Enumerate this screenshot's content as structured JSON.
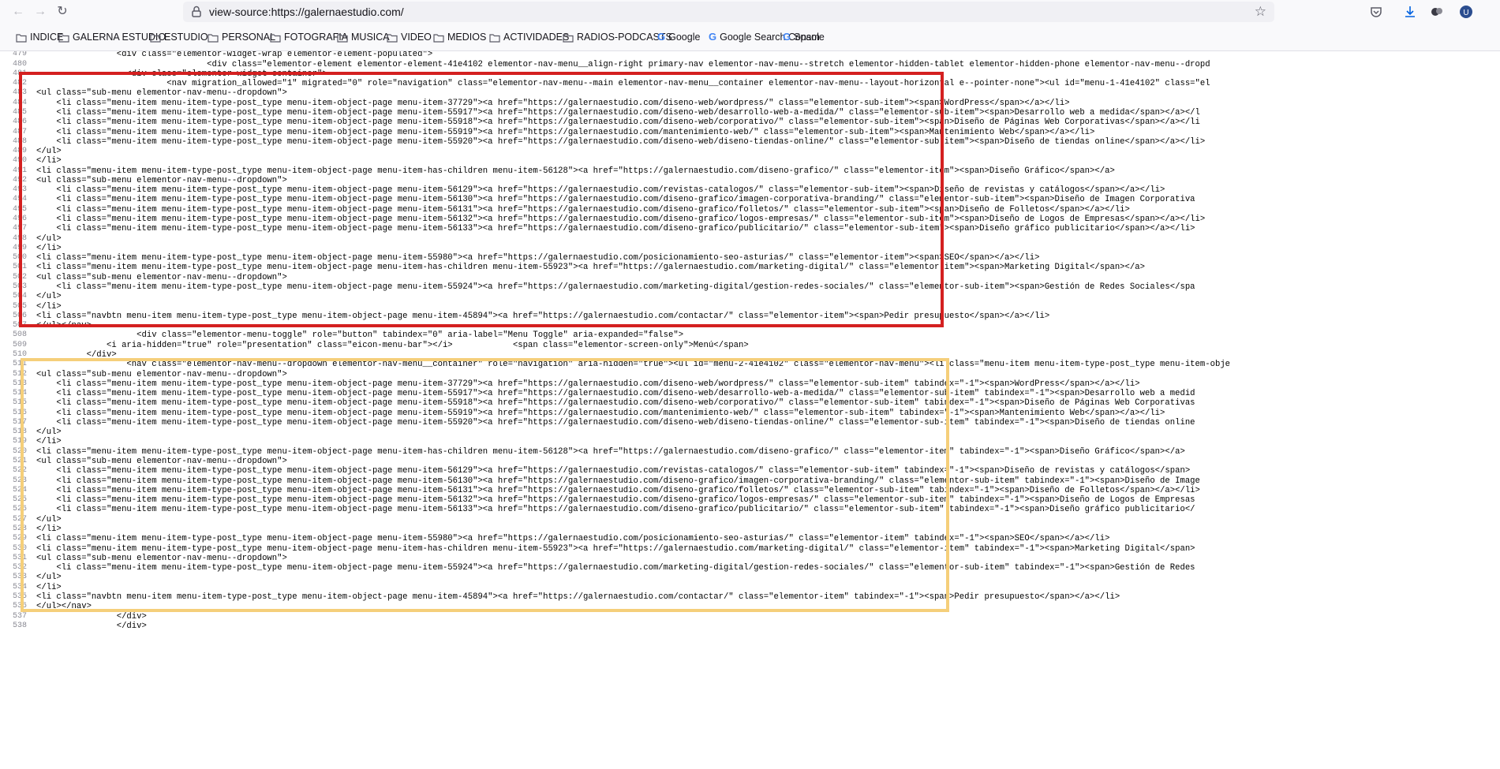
{
  "browser": {
    "url": "view-source:https://galernaestudio.com/",
    "nav_icons": [
      "back-arrow-icon",
      "forward-arrow-icon",
      "reload-icon"
    ],
    "right_icons": [
      "pocket-icon",
      "download-icon",
      "extension-icon",
      "profile-icon"
    ]
  },
  "bookmarks": [
    {
      "label": "INDICE",
      "icon": "folder-icon"
    },
    {
      "label": "GALERNA ESTUDIO",
      "icon": "folder-icon"
    },
    {
      "label": "ESTUDIO",
      "icon": "folder-icon"
    },
    {
      "label": "PERSONAL",
      "icon": "folder-icon"
    },
    {
      "label": "FOTOGRAFIA",
      "icon": "folder-icon"
    },
    {
      "label": "MUSICA",
      "icon": "folder-icon"
    },
    {
      "label": "VIDEO",
      "icon": "folder-icon"
    },
    {
      "label": "MEDIOS",
      "icon": "folder-icon"
    },
    {
      "label": "ACTIVIDADES",
      "icon": "folder-icon"
    },
    {
      "label": "RADIOS-PODCASTS",
      "icon": "folder-icon"
    },
    {
      "label": "Google",
      "icon": "google-icon"
    },
    {
      "label": "Google Search Console",
      "icon": "google-icon"
    },
    {
      "label": "Spam",
      "icon": "google-icon"
    }
  ],
  "highlights": {
    "red": "#d42020",
    "yellow": "#f5cf7a"
  },
  "source_lines": [
    {
      "n": "",
      "text": "                    <div class=\"elementor-widget-wrap elementor-element-populated\">"
    },
    {
      "n": "479",
      "text": "                <div class=\"elementor-widget-wrap elementor-element-populated\">"
    },
    {
      "n": "480",
      "text": "                                  <div class=\"elementor-element elementor-element-41e4102 elementor-nav-menu__align-right primary-nav elementor-nav-menu--stretch elementor-hidden-tablet elementor-hidden-phone elementor-nav-menu--dropd"
    },
    {
      "n": "481",
      "text": "                  <div class=\"elementor-widget-container\">"
    },
    {
      "n": "482",
      "text": "                          <nav migration_allowed=\"1\" migrated=\"0\" role=\"navigation\" class=\"elementor-nav-menu--main elementor-nav-menu__container elementor-nav-menu--layout-horizontal e--pointer-none\"><ul id=\"menu-1-41e4102\" class=\"el"
    },
    {
      "n": "483",
      "text": "<ul class=\"sub-menu elementor-nav-menu--dropdown\">"
    },
    {
      "n": "484",
      "text": "    <li class=\"menu-item menu-item-type-post_type menu-item-object-page menu-item-37729\"><a href=\"https://galernaestudio.com/diseno-web/wordpress/\" class=\"elementor-sub-item\"><span>WordPress</span></a></li>"
    },
    {
      "n": "485",
      "text": "    <li class=\"menu-item menu-item-type-post_type menu-item-object-page menu-item-55917\"><a href=\"https://galernaestudio.com/diseno-web/desarrollo-web-a-medida/\" class=\"elementor-sub-item\"><span>Desarrollo web a medida</span></a></l"
    },
    {
      "n": "486",
      "text": "    <li class=\"menu-item menu-item-type-post_type menu-item-object-page menu-item-55918\"><a href=\"https://galernaestudio.com/diseno-web/corporativo/\" class=\"elementor-sub-item\"><span>Diseño de Páginas Web Corporativas</span></a></li"
    },
    {
      "n": "487",
      "text": "    <li class=\"menu-item menu-item-type-post_type menu-item-object-page menu-item-55919\"><a href=\"https://galernaestudio.com/mantenimiento-web/\" class=\"elementor-sub-item\"><span>Mantenimiento Web</span></a></li>"
    },
    {
      "n": "488",
      "text": "    <li class=\"menu-item menu-item-type-post_type menu-item-object-page menu-item-55920\"><a href=\"https://galernaestudio.com/diseno-web/diseno-tiendas-online/\" class=\"elementor-sub-item\"><span>Diseño de tiendas online</span></a></li>"
    },
    {
      "n": "489",
      "text": "</ul>"
    },
    {
      "n": "490",
      "text": "</li>"
    },
    {
      "n": "491",
      "text": "<li class=\"menu-item menu-item-type-post_type menu-item-object-page menu-item-has-children menu-item-56128\"><a href=\"https://galernaestudio.com/diseno-grafico/\" class=\"elementor-item\"><span>Diseño Gráfico</span></a>"
    },
    {
      "n": "492",
      "text": "<ul class=\"sub-menu elementor-nav-menu--dropdown\">"
    },
    {
      "n": "493",
      "text": "    <li class=\"menu-item menu-item-type-post_type menu-item-object-page menu-item-56129\"><a href=\"https://galernaestudio.com/revistas-catalogos/\" class=\"elementor-sub-item\"><span>Diseño de revistas y catálogos</span></a></li>"
    },
    {
      "n": "494",
      "text": "    <li class=\"menu-item menu-item-type-post_type menu-item-object-page menu-item-56130\"><a href=\"https://galernaestudio.com/diseno-grafico/imagen-corporativa-branding/\" class=\"elementor-sub-item\"><span>Diseño de Imagen Corporativa"
    },
    {
      "n": "495",
      "text": "    <li class=\"menu-item menu-item-type-post_type menu-item-object-page menu-item-56131\"><a href=\"https://galernaestudio.com/diseno-grafico/folletos/\" class=\"elementor-sub-item\"><span>Diseño de Folletos</span></a></li>"
    },
    {
      "n": "496",
      "text": "    <li class=\"menu-item menu-item-type-post_type menu-item-object-page menu-item-56132\"><a href=\"https://galernaestudio.com/diseno-grafico/logos-empresas/\" class=\"elementor-sub-item\"><span>Diseño de Logos de Empresas</span></a></li>"
    },
    {
      "n": "497",
      "text": "    <li class=\"menu-item menu-item-type-post_type menu-item-object-page menu-item-56133\"><a href=\"https://galernaestudio.com/diseno-grafico/publicitario/\" class=\"elementor-sub-item\"><span>Diseño gráfico publicitario</span></a></li>"
    },
    {
      "n": "498",
      "text": "</ul>"
    },
    {
      "n": "499",
      "text": "</li>"
    },
    {
      "n": "500",
      "text": "<li class=\"menu-item menu-item-type-post_type menu-item-object-page menu-item-55980\"><a href=\"https://galernaestudio.com/posicionamiento-seo-asturias/\" class=\"elementor-item\"><span>SEO</span></a></li>"
    },
    {
      "n": "501",
      "text": "<li class=\"menu-item menu-item-type-post_type menu-item-object-page menu-item-has-children menu-item-55923\"><a href=\"https://galernaestudio.com/marketing-digital/\" class=\"elementor-item\"><span>Marketing Digital</span></a>"
    },
    {
      "n": "502",
      "text": "<ul class=\"sub-menu elementor-nav-menu--dropdown\">"
    },
    {
      "n": "503",
      "text": "    <li class=\"menu-item menu-item-type-post_type menu-item-object-page menu-item-55924\"><a href=\"https://galernaestudio.com/marketing-digital/gestion-redes-sociales/\" class=\"elementor-sub-item\"><span>Gestión de Redes Sociales</spa"
    },
    {
      "n": "504",
      "text": "</ul>"
    },
    {
      "n": "505",
      "text": "</li>"
    },
    {
      "n": "506",
      "text": "<li class=\"navbtn menu-item menu-item-type-post_type menu-item-object-page menu-item-45894\"><a href=\"https://galernaestudio.com/contactar/\" class=\"elementor-item\"><span>Pedir presupuesto</span></a></li>"
    },
    {
      "n": "507",
      "text": "</ul></nav>"
    },
    {
      "n": "508",
      "text": "                    <div class=\"elementor-menu-toggle\" role=\"button\" tabindex=\"0\" aria-label=\"Menu Toggle\" aria-expanded=\"false\">"
    },
    {
      "n": "509",
      "text": "              <i aria-hidden=\"true\" role=\"presentation\" class=\"eicon-menu-bar\"></i>            <span class=\"elementor-screen-only\">Menú</span>"
    },
    {
      "n": "510",
      "text": "          </div>"
    },
    {
      "n": "511",
      "text": "                  <nav class=\"elementor-nav-menu--dropdown elementor-nav-menu__container\" role=\"navigation\" aria-hidden=\"true\"><ul id=\"menu-2-41e4102\" class=\"elementor-nav-menu\"><li class=\"menu-item menu-item-type-post_type menu-item-obje"
    },
    {
      "n": "512",
      "text": "<ul class=\"sub-menu elementor-nav-menu--dropdown\">"
    },
    {
      "n": "513",
      "text": "    <li class=\"menu-item menu-item-type-post_type menu-item-object-page menu-item-37729\"><a href=\"https://galernaestudio.com/diseno-web/wordpress/\" class=\"elementor-sub-item\" tabindex=\"-1\"><span>WordPress</span></a></li>"
    },
    {
      "n": "514",
      "text": "    <li class=\"menu-item menu-item-type-post_type menu-item-object-page menu-item-55917\"><a href=\"https://galernaestudio.com/diseno-web/desarrollo-web-a-medida/\" class=\"elementor-sub-item\" tabindex=\"-1\"><span>Desarrollo web a medid"
    },
    {
      "n": "515",
      "text": "    <li class=\"menu-item menu-item-type-post_type menu-item-object-page menu-item-55918\"><a href=\"https://galernaestudio.com/diseno-web/corporativo/\" class=\"elementor-sub-item\" tabindex=\"-1\"><span>Diseño de Páginas Web Corporativas"
    },
    {
      "n": "516",
      "text": "    <li class=\"menu-item menu-item-type-post_type menu-item-object-page menu-item-55919\"><a href=\"https://galernaestudio.com/mantenimiento-web/\" class=\"elementor-sub-item\" tabindex=\"-1\"><span>Mantenimiento Web</span></a></li>"
    },
    {
      "n": "517",
      "text": "    <li class=\"menu-item menu-item-type-post_type menu-item-object-page menu-item-55920\"><a href=\"https://galernaestudio.com/diseno-web/diseno-tiendas-online/\" class=\"elementor-sub-item\" tabindex=\"-1\"><span>Diseño de tiendas online"
    },
    {
      "n": "518",
      "text": "</ul>"
    },
    {
      "n": "519",
      "text": "</li>"
    },
    {
      "n": "520",
      "text": "<li class=\"menu-item menu-item-type-post_type menu-item-object-page menu-item-has-children menu-item-56128\"><a href=\"https://galernaestudio.com/diseno-grafico/\" class=\"elementor-item\" tabindex=\"-1\"><span>Diseño Gráfico</span></a>"
    },
    {
      "n": "521",
      "text": "<ul class=\"sub-menu elementor-nav-menu--dropdown\">"
    },
    {
      "n": "522",
      "text": "    <li class=\"menu-item menu-item-type-post_type menu-item-object-page menu-item-56129\"><a href=\"https://galernaestudio.com/revistas-catalogos/\" class=\"elementor-sub-item\" tabindex=\"-1\"><span>Diseño de revistas y catálogos</span>"
    },
    {
      "n": "523",
      "text": "    <li class=\"menu-item menu-item-type-post_type menu-item-object-page menu-item-56130\"><a href=\"https://galernaestudio.com/diseno-grafico/imagen-corporativa-branding/\" class=\"elementor-sub-item\" tabindex=\"-1\"><span>Diseño de Image"
    },
    {
      "n": "524",
      "text": "    <li class=\"menu-item menu-item-type-post_type menu-item-object-page menu-item-56131\"><a href=\"https://galernaestudio.com/diseno-grafico/folletos/\" class=\"elementor-sub-item\" tabindex=\"-1\"><span>Diseño de Folletos</span></a></li>"
    },
    {
      "n": "525",
      "text": "    <li class=\"menu-item menu-item-type-post_type menu-item-object-page menu-item-56132\"><a href=\"https://galernaestudio.com/diseno-grafico/logos-empresas/\" class=\"elementor-sub-item\" tabindex=\"-1\"><span>Diseño de Logos de Empresas"
    },
    {
      "n": "526",
      "text": "    <li class=\"menu-item menu-item-type-post_type menu-item-object-page menu-item-56133\"><a href=\"https://galernaestudio.com/diseno-grafico/publicitario/\" class=\"elementor-sub-item\" tabindex=\"-1\"><span>Diseño gráfico publicitario</"
    },
    {
      "n": "527",
      "text": "</ul>"
    },
    {
      "n": "528",
      "text": "</li>"
    },
    {
      "n": "529",
      "text": "<li class=\"menu-item menu-item-type-post_type menu-item-object-page menu-item-55980\"><a href=\"https://galernaestudio.com/posicionamiento-seo-asturias/\" class=\"elementor-item\" tabindex=\"-1\"><span>SEO</span></a></li>"
    },
    {
      "n": "530",
      "text": "<li class=\"menu-item menu-item-type-post_type menu-item-object-page menu-item-has-children menu-item-55923\"><a href=\"https://galernaestudio.com/marketing-digital/\" class=\"elementor-item\" tabindex=\"-1\"><span>Marketing Digital</span>"
    },
    {
      "n": "531",
      "text": "<ul class=\"sub-menu elementor-nav-menu--dropdown\">"
    },
    {
      "n": "532",
      "text": "    <li class=\"menu-item menu-item-type-post_type menu-item-object-page menu-item-55924\"><a href=\"https://galernaestudio.com/marketing-digital/gestion-redes-sociales/\" class=\"elementor-sub-item\" tabindex=\"-1\"><span>Gestión de Redes"
    },
    {
      "n": "533",
      "text": "</ul>"
    },
    {
      "n": "534",
      "text": "</li>"
    },
    {
      "n": "535",
      "text": "<li class=\"navbtn menu-item menu-item-type-post_type menu-item-object-page menu-item-45894\"><a href=\"https://galernaestudio.com/contactar/\" class=\"elementor-item\" tabindex=\"-1\"><span>Pedir presupuesto</span></a></li>"
    },
    {
      "n": "536",
      "text": "</ul></nav>"
    },
    {
      "n": "537",
      "text": "                </div>"
    },
    {
      "n": "538",
      "text": "                </div>"
    }
  ]
}
